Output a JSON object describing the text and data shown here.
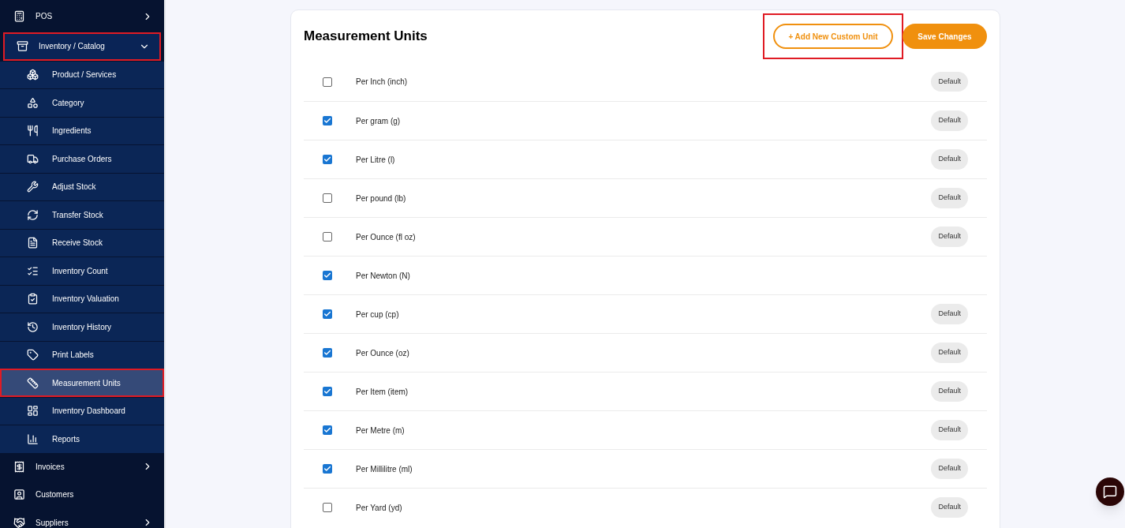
{
  "sidebar": {
    "items": [
      {
        "label": "POS",
        "expanded": false,
        "highlighted": false
      },
      {
        "label": "Inventory / Catalog",
        "expanded": true,
        "highlighted": true,
        "children": [
          {
            "label": "Product / Services",
            "selected": false,
            "highlighted": false
          },
          {
            "label": "Category",
            "selected": false,
            "highlighted": false
          },
          {
            "label": "Ingredients",
            "selected": false,
            "highlighted": false
          },
          {
            "label": "Purchase Orders",
            "selected": false,
            "highlighted": false
          },
          {
            "label": "Adjust Stock",
            "selected": false,
            "highlighted": false
          },
          {
            "label": "Transfer Stock",
            "selected": false,
            "highlighted": false
          },
          {
            "label": "Receive Stock",
            "selected": false,
            "highlighted": false
          },
          {
            "label": "Inventory Count",
            "selected": false,
            "highlighted": false
          },
          {
            "label": "Inventory Valuation",
            "selected": false,
            "highlighted": false
          },
          {
            "label": "Inventory History",
            "selected": false,
            "highlighted": false
          },
          {
            "label": "Print Labels",
            "selected": false,
            "highlighted": false
          },
          {
            "label": "Measurement Units",
            "selected": true,
            "highlighted": true
          },
          {
            "label": "Inventory Dashboard",
            "selected": false,
            "highlighted": false
          },
          {
            "label": "Reports",
            "selected": false,
            "highlighted": false
          }
        ]
      },
      {
        "label": "Invoices",
        "expanded": false,
        "highlighted": false
      },
      {
        "label": "Customers",
        "highlighted": false
      },
      {
        "label": "Suppliers",
        "expanded": false,
        "highlighted": false
      }
    ]
  },
  "card": {
    "title": "Measurement Units",
    "add_button": {
      "label": "+ Add New Custom Unit",
      "highlighted": true
    },
    "save_button": {
      "label": "Save Changes"
    },
    "units": [
      {
        "name": "Per Inch (inch)",
        "checked": false,
        "default": true,
        "badge": "Default"
      },
      {
        "name": "Per gram (g)",
        "checked": true,
        "default": true,
        "badge": "Default"
      },
      {
        "name": "Per Litre (l)",
        "checked": true,
        "default": true,
        "badge": "Default"
      },
      {
        "name": "Per pound (lb)",
        "checked": false,
        "default": true,
        "badge": "Default"
      },
      {
        "name": "Per Ounce (fl oz)",
        "checked": false,
        "default": true,
        "badge": "Default"
      },
      {
        "name": "Per Newton (N)",
        "checked": true,
        "default": false
      },
      {
        "name": "Per cup (cp)",
        "checked": true,
        "default": true,
        "badge": "Default"
      },
      {
        "name": "Per Ounce (oz)",
        "checked": true,
        "default": true,
        "badge": "Default"
      },
      {
        "name": "Per Item (item)",
        "checked": true,
        "default": true,
        "badge": "Default"
      },
      {
        "name": "Per Metre (m)",
        "checked": true,
        "default": true,
        "badge": "Default"
      },
      {
        "name": "Per Millilitre (ml)",
        "checked": true,
        "default": true,
        "badge": "Default"
      },
      {
        "name": "Per Yard (yd)",
        "checked": false,
        "default": true,
        "badge": "Default"
      }
    ]
  }
}
